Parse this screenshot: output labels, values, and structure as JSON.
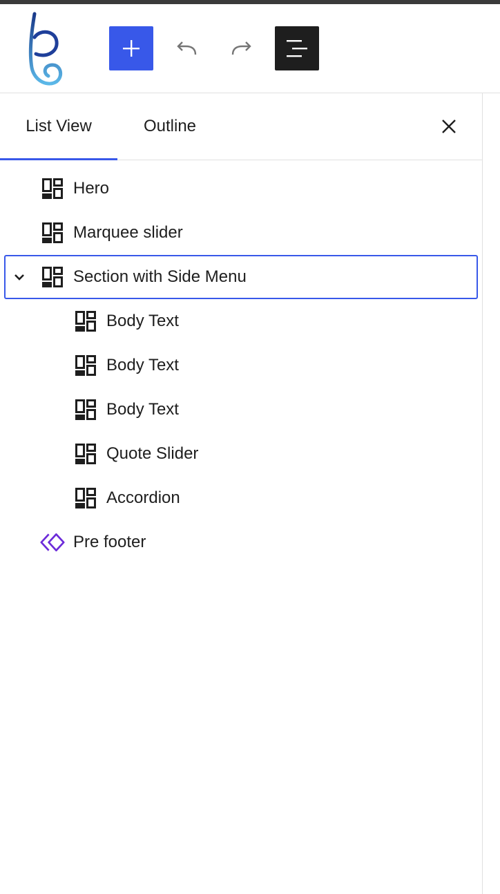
{
  "tabs": {
    "list_view": "List View",
    "outline": "Outline"
  },
  "tree": {
    "items": [
      {
        "label": "Hero",
        "icon": "block-layout-icon",
        "level": 1
      },
      {
        "label": "Marquee slider",
        "icon": "block-layout-icon",
        "level": 1
      },
      {
        "label": "Section with Side Menu",
        "icon": "block-layout-icon",
        "level": 1,
        "expanded": true,
        "selected": true
      },
      {
        "label": "Body Text",
        "icon": "block-layout-icon",
        "level": 2
      },
      {
        "label": "Body Text",
        "icon": "block-layout-icon",
        "level": 2
      },
      {
        "label": "Body Text",
        "icon": "block-layout-icon",
        "level": 2
      },
      {
        "label": "Quote Slider",
        "icon": "block-layout-icon",
        "level": 2
      },
      {
        "label": "Accordion",
        "icon": "block-layout-icon",
        "level": 2
      },
      {
        "label": "Pre footer",
        "icon": "reusable-block-icon",
        "level": 1
      }
    ]
  },
  "colors": {
    "accent": "#3858e9",
    "dark": "#1e1e1e",
    "reusable": "#6c2bd9"
  }
}
